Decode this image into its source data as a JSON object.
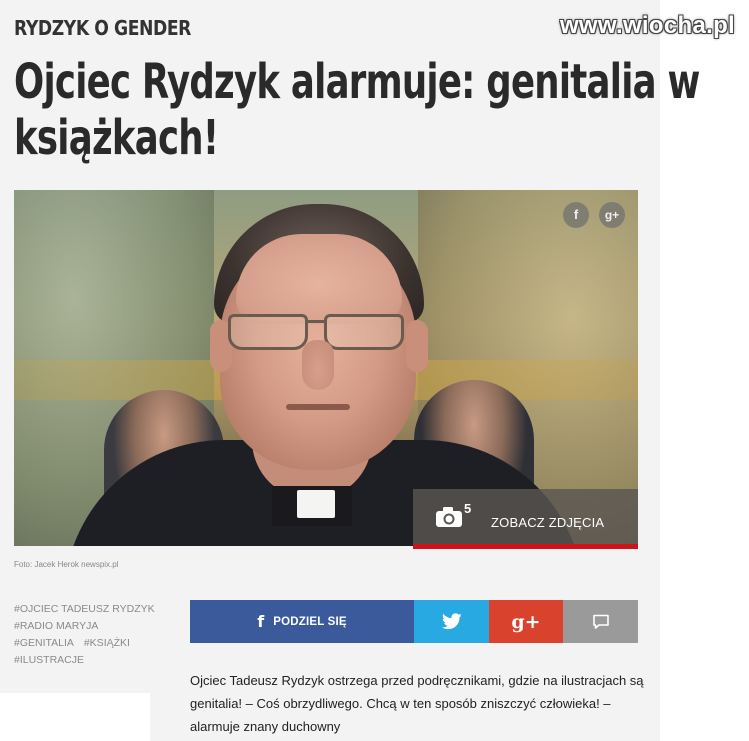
{
  "watermark": "www.wiocha.pl",
  "article": {
    "kicker": "RYDZYK O GENDER",
    "headline": "Ojciec Rydzyk alarmuje: genitalia w książkach!",
    "photo_credit": "Foto: Jacek Herok newspix.pl",
    "photo_share": {
      "facebook": "f",
      "google": "g+"
    },
    "gallery": {
      "count": "5",
      "label": "ZOBACZ ZDJĘCIA"
    },
    "tags": [
      "#OJCIEC TADEUSZ RYDZYK",
      "#RADIO MARYJA",
      "#GENITALIA",
      "#KSIĄŻKI",
      "#ILUSTRACJE"
    ],
    "share": {
      "facebook_label": "PODZIEL SIĘ",
      "facebook_icon": "facebook-icon",
      "twitter_icon": "twitter-icon",
      "google_plus_label": "g+",
      "comment_icon": "comment-icon",
      "colors": {
        "facebook": "#3a5a9b",
        "twitter": "#28a9e1",
        "google": "#d9432e",
        "comment": "#9a9a9a",
        "accent": "#d0131b"
      }
    },
    "lead": "Ojciec Tadeusz Rydzyk ostrzega przed podręcznikami, gdzie na ilustracjach są genitalia! – Coś obrzydliwego. Chcą w ten sposób zniszczyć człowieka! – alarmuje znany duchowny"
  }
}
